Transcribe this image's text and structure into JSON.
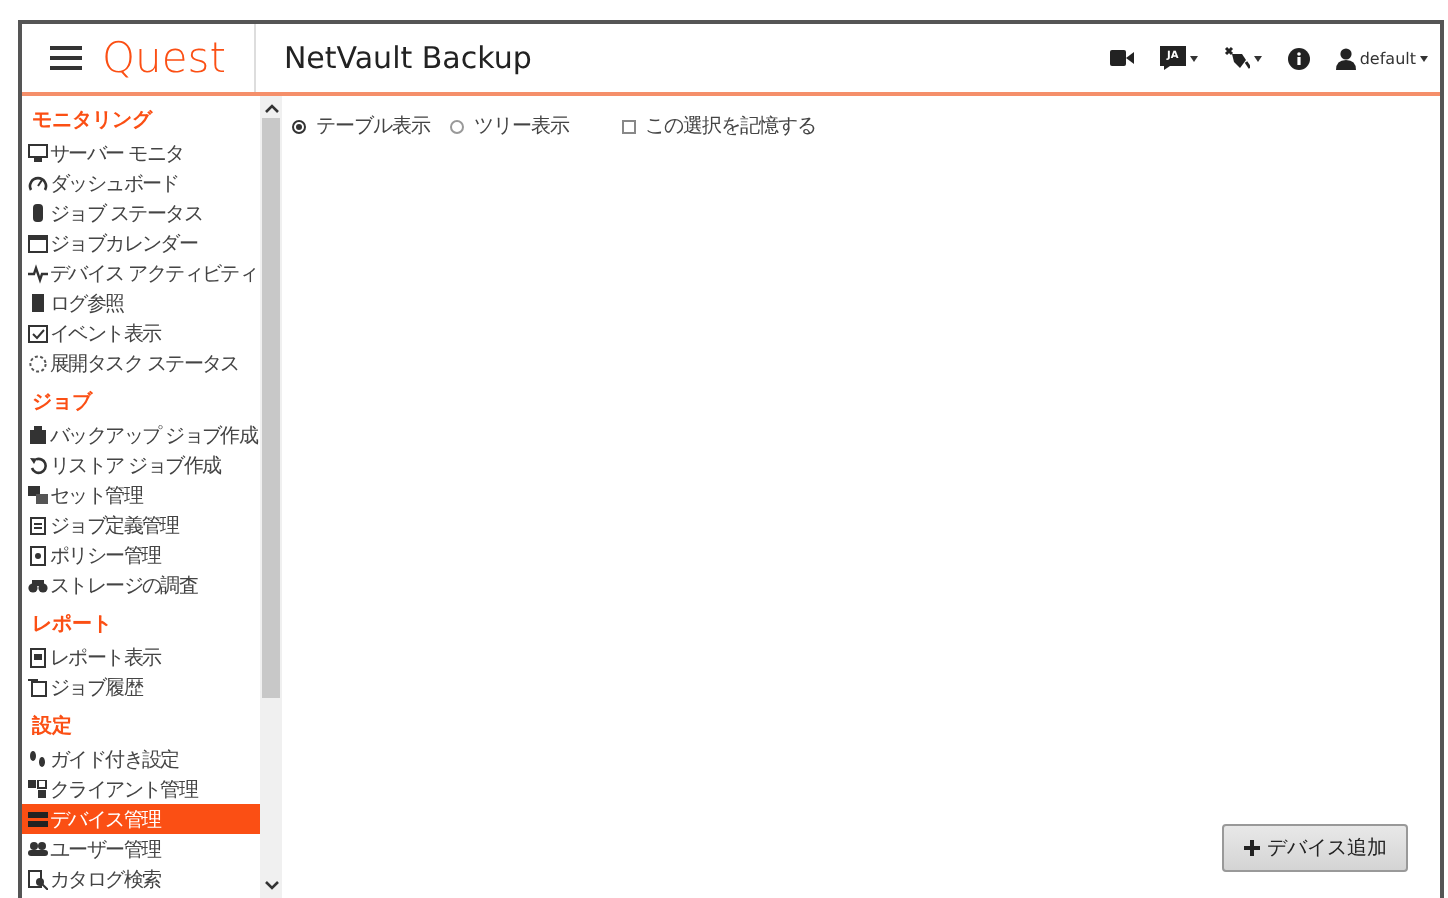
{
  "header": {
    "brand": "Quest",
    "title": "NetVault Backup",
    "language": "JA",
    "user": "default"
  },
  "sidebar": {
    "sections": [
      {
        "title": "モニタリング",
        "items": [
          {
            "label": "サーバー モニタ",
            "selected": false
          },
          {
            "label": "ダッシュボード",
            "selected": false
          },
          {
            "label": "ジョブ ステータス",
            "selected": false
          },
          {
            "label": "ジョブカレンダー",
            "selected": false
          },
          {
            "label": "デバイス アクティビティ",
            "selected": false
          },
          {
            "label": "ログ参照",
            "selected": false
          },
          {
            "label": "イベント表示",
            "selected": false
          },
          {
            "label": "展開タスク ステータス",
            "selected": false
          }
        ]
      },
      {
        "title": "ジョブ",
        "items": [
          {
            "label": "バックアップ ジョブ作成",
            "selected": false
          },
          {
            "label": "リストア ジョブ作成",
            "selected": false
          },
          {
            "label": "セット管理",
            "selected": false
          },
          {
            "label": "ジョブ定義管理",
            "selected": false
          },
          {
            "label": "ポリシー管理",
            "selected": false
          },
          {
            "label": "ストレージの調査",
            "selected": false
          }
        ]
      },
      {
        "title": "レポート",
        "items": [
          {
            "label": "レポート表示",
            "selected": false
          },
          {
            "label": "ジョブ履歴",
            "selected": false
          }
        ]
      },
      {
        "title": "設定",
        "items": [
          {
            "label": "ガイド付き設定",
            "selected": false
          },
          {
            "label": "クライアント管理",
            "selected": false
          },
          {
            "label": "デバイス管理",
            "selected": true
          },
          {
            "label": "ユーザー管理",
            "selected": false
          },
          {
            "label": "カタログ検索",
            "selected": false
          }
        ]
      }
    ]
  },
  "view_options": [
    {
      "label": "テーブル表示",
      "selected": true
    },
    {
      "label": "ツリー表示",
      "selected": false
    }
  ],
  "remember_selection": {
    "label": "この選択を記憶する",
    "checked": false
  },
  "add_device_button": {
    "label": "デバイス追加"
  }
}
